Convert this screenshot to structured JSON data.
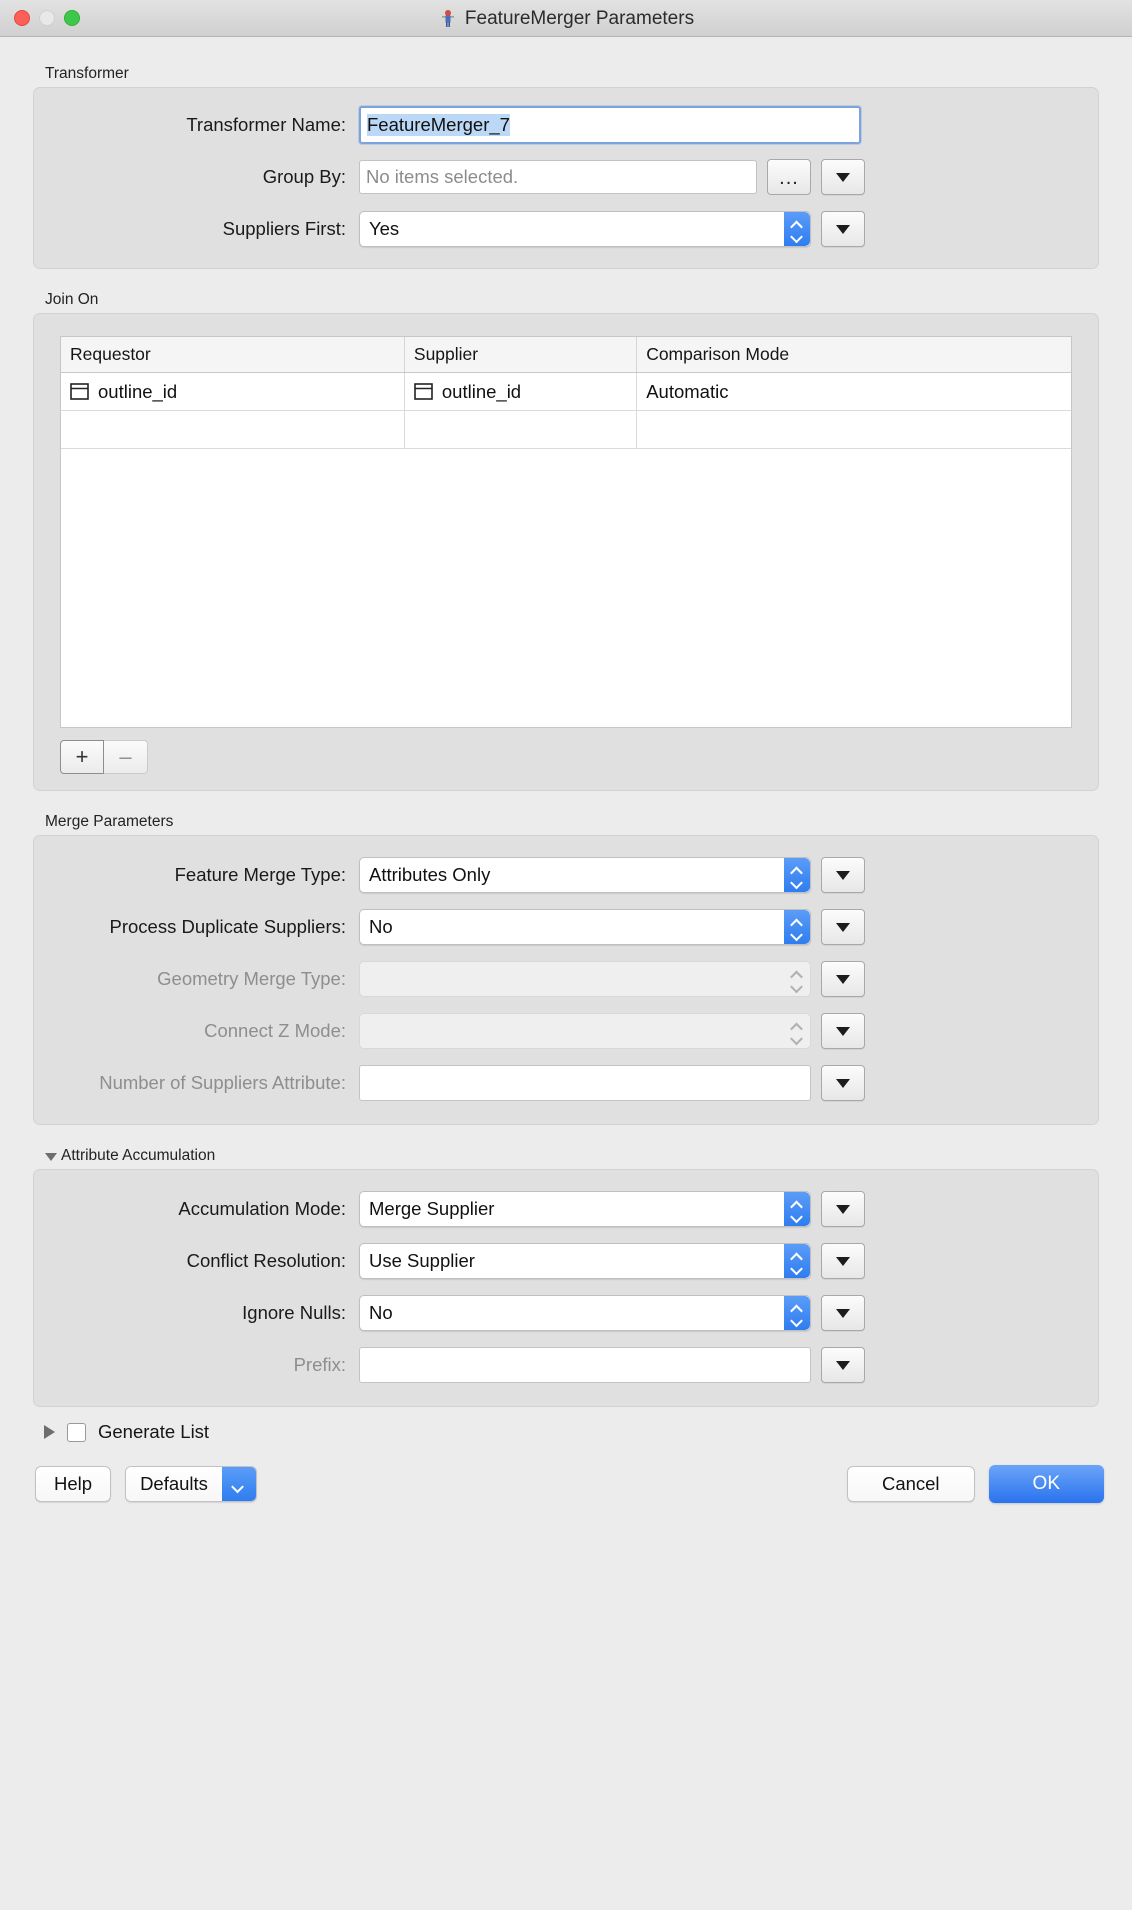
{
  "window": {
    "title": "FeatureMerger Parameters",
    "app_icon": "featuremerger-icon",
    "controls": {
      "close": "close",
      "minimize": "minimize",
      "zoom": "zoom"
    }
  },
  "sections": {
    "transformer": {
      "label": "Transformer",
      "transformer_name": {
        "label": "Transformer Name:",
        "value": "FeatureMerger_7"
      },
      "group_by": {
        "label": "Group By:",
        "value": "",
        "placeholder": "No items selected.",
        "browse_label": "..."
      },
      "suppliers_first": {
        "label": "Suppliers First:",
        "value": "Yes"
      }
    },
    "join_on": {
      "label": "Join On",
      "columns": [
        "Requestor",
        "Supplier",
        "Comparison Mode"
      ],
      "rows": [
        {
          "requestor": "outline_id",
          "supplier": "outline_id",
          "comparison_mode": "Automatic"
        },
        {
          "requestor": "",
          "supplier": "",
          "comparison_mode": ""
        }
      ],
      "add_label": "+",
      "remove_label": "–"
    },
    "merge_parameters": {
      "label": "Merge Parameters",
      "fields": [
        {
          "label": "Feature Merge Type:",
          "value": "Attributes Only",
          "type": "combo",
          "enabled": true
        },
        {
          "label": "Process Duplicate Suppliers:",
          "value": "No",
          "type": "combo",
          "enabled": true
        },
        {
          "label": "Geometry Merge Type:",
          "value": "",
          "type": "combo",
          "enabled": false
        },
        {
          "label": "Connect Z Mode:",
          "value": "",
          "type": "combo",
          "enabled": false
        },
        {
          "label": "Number of Suppliers Attribute:",
          "value": "",
          "type": "text",
          "enabled": false
        }
      ]
    },
    "attribute_accumulation": {
      "label": "Attribute Accumulation",
      "expanded": true,
      "fields": [
        {
          "label": "Accumulation Mode:",
          "value": "Merge Supplier",
          "type": "combo",
          "enabled": true
        },
        {
          "label": "Conflict Resolution:",
          "value": "Use Supplier",
          "type": "combo",
          "enabled": true
        },
        {
          "label": "Ignore Nulls:",
          "value": "No",
          "type": "combo",
          "enabled": true
        },
        {
          "label": "Prefix:",
          "value": "",
          "type": "text",
          "enabled": false
        }
      ]
    }
  },
  "footer": {
    "generate_list": {
      "label": "Generate List",
      "checked": false,
      "expanded": false
    },
    "help_label": "Help",
    "defaults_label": "Defaults",
    "cancel_label": "Cancel",
    "ok_label": "OK"
  },
  "colors": {
    "accent_blue": "#2f7df0",
    "selection_blue": "#bcd8f7",
    "focus_ring": "#7ba4de",
    "window_bg": "#ececec",
    "group_bg": "#e0e0e0"
  }
}
